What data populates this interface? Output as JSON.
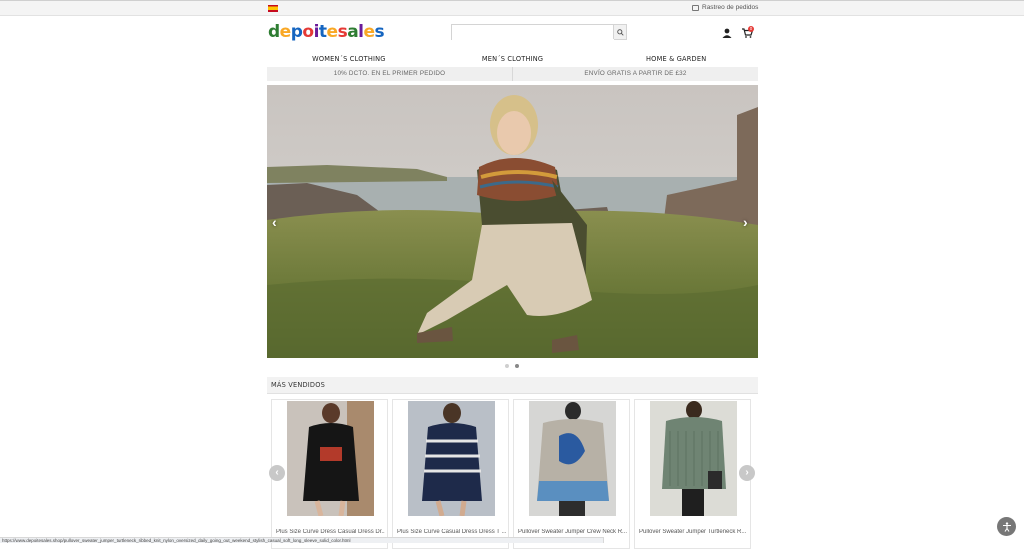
{
  "topbar": {
    "language_flag": "spain-flag-icon",
    "tracking_label": "Rastreo de pedidos",
    "tracking_icon": "truck-icon"
  },
  "header": {
    "logo_text": "depoitesales",
    "logo_letters": [
      {
        "ch": "d",
        "color": "#2e7d32"
      },
      {
        "ch": "e",
        "color": "#f9a825"
      },
      {
        "ch": "p",
        "color": "#1565c0"
      },
      {
        "ch": "o",
        "color": "#e53935"
      },
      {
        "ch": "i",
        "color": "#6a1b9a"
      },
      {
        "ch": "t",
        "color": "#1565c0"
      },
      {
        "ch": "e",
        "color": "#f9a825"
      },
      {
        "ch": "s",
        "color": "#e53935"
      },
      {
        "ch": "a",
        "color": "#2e7d32"
      },
      {
        "ch": "l",
        "color": "#6a1b9a"
      },
      {
        "ch": "e",
        "color": "#f9a825"
      },
      {
        "ch": "s",
        "color": "#1565c0"
      }
    ],
    "search_placeholder": "",
    "search_icon": "search-icon",
    "user_icon": "user-icon",
    "cart_icon": "cart-icon",
    "cart_count": "0"
  },
  "nav": {
    "items": [
      {
        "label": "WOMEN´S CLOTHING"
      },
      {
        "label": "MEN´S CLOTHING"
      },
      {
        "label": "HOME & GARDEN"
      }
    ]
  },
  "promo": {
    "left": "10% DCTO. EN EL PRIMER PEDIDO",
    "right": "ENVÍO GRATIS A PARTIR DE £32"
  },
  "hero": {
    "prev_icon": "chevron-left-icon",
    "next_icon": "chevron-right-icon",
    "slides": 2,
    "active_slide": 2
  },
  "bestsellers": {
    "title": "MÁS VENDIDOS",
    "products": [
      {
        "name": "Plus Size Curve Dress Casual Dress Dr...",
        "price": "",
        "bg": "#c9c2bb"
      },
      {
        "name": "Plus Size Curve Casual Dress Dress T ...",
        "price": "",
        "bg": "#b9bfc7"
      },
      {
        "name": "Pullover Sweater Jumper Crew Neck R...",
        "price": "",
        "bg": "#d6d6d4"
      },
      {
        "name": "Pullover Sweater Jumper Turtleneck R...",
        "price": "",
        "bg": "#dcdcd6"
      }
    ],
    "prev_icon": "chevron-left-icon",
    "next_icon": "chevron-right-icon"
  },
  "status_url": "https://www.depoitesales.shop/pullover_sweater_jumper_turtleneck_ribbed_knit_nylon_oversized_daily_going_out_weekend_stylish_casual_soft_long_sleeve_solid_color.html",
  "accessibility_icon": "accessibility-icon"
}
